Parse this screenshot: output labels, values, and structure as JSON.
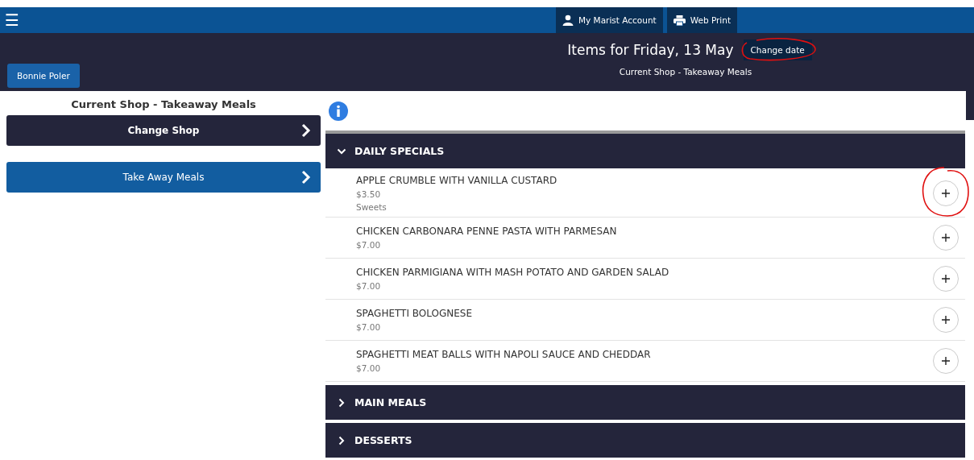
{
  "top_bar": {
    "menu_icon": "☰",
    "buttons": [
      {
        "label": "My Marist Account",
        "kind": "account"
      },
      {
        "label": "Web Print",
        "kind": "print"
      }
    ]
  },
  "header": {
    "user": "Bonnie Poler",
    "title": "Items for Friday, 13 May",
    "change_date": "Change date",
    "subtitle": "Current Shop - Takeaway Meals"
  },
  "sidebar": {
    "heading": "Current Shop - Takeaway Meals",
    "items": [
      {
        "label": "Change Shop",
        "kind": "action"
      },
      {
        "label": "Take Away Meals",
        "kind": "shop"
      }
    ]
  },
  "sections": [
    {
      "title": "DAILY SPECIALS",
      "expanded": true,
      "items": [
        {
          "name": "APPLE CRUMBLE WITH VANILLA CUSTARD",
          "price": "$3.50",
          "category": "Sweets"
        },
        {
          "name": "CHICKEN CARBONARA PENNE PASTA WITH PARMESAN",
          "price": "$7.00"
        },
        {
          "name": "CHICKEN PARMIGIANA WITH MASH POTATO AND GARDEN SALAD",
          "price": "$7.00"
        },
        {
          "name": "SPAGHETTI BOLOGNESE",
          "price": "$7.00"
        },
        {
          "name": "SPAGHETTI MEAT BALLS WITH NAPOLI SAUCE AND CHEDDAR",
          "price": "$7.00"
        }
      ]
    },
    {
      "title": "MAIN MEALS",
      "expanded": false
    },
    {
      "title": "DESSERTS",
      "expanded": false
    }
  ]
}
